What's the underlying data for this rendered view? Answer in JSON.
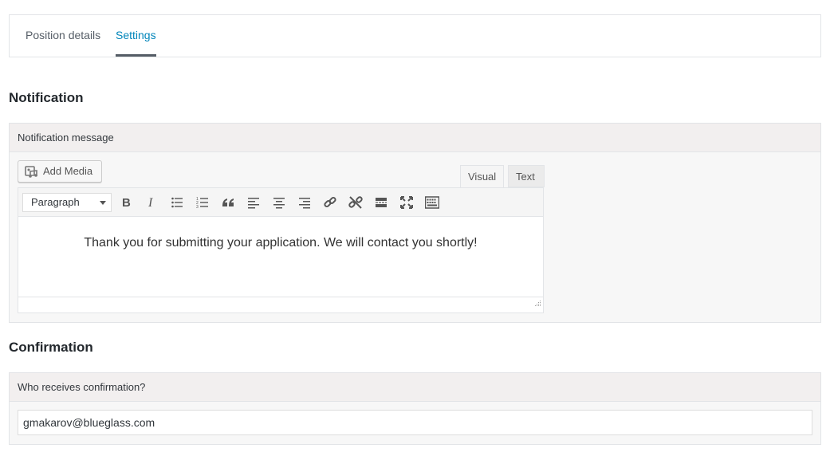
{
  "tabs": [
    {
      "label": "Position details",
      "active": false
    },
    {
      "label": "Settings",
      "active": true
    }
  ],
  "notification": {
    "section_title": "Notification",
    "panel_label": "Notification message",
    "add_media_label": "Add Media",
    "editor_tabs": {
      "visual": "Visual",
      "text": "Text",
      "active": "Visual"
    },
    "format_select": "Paragraph",
    "toolbar_icons": [
      "bold-icon",
      "italic-icon",
      "bulleted-list-icon",
      "numbered-list-icon",
      "blockquote-icon",
      "align-left-icon",
      "align-center-icon",
      "align-right-icon",
      "link-icon",
      "unlink-icon",
      "read-more-icon",
      "fullscreen-icon",
      "toolbar-toggle-icon"
    ],
    "message": "Thank you for submitting your application. We will contact you shortly!"
  },
  "confirmation": {
    "section_title": "Confirmation",
    "panel_label": "Who receives confirmation?",
    "email_value": "gmakarov@blueglass.com"
  },
  "colors": {
    "accent": "#0085ba",
    "panel_header_bg": "#f2efef",
    "border": "#e2e4e7"
  }
}
